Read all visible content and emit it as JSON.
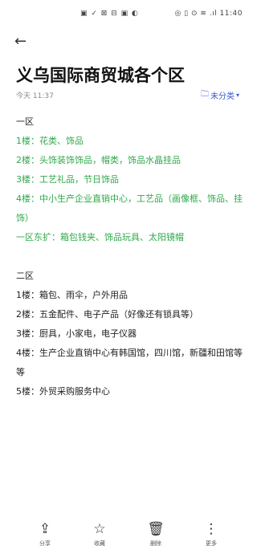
{
  "status_bar": {
    "left_text": "▣ ✓ ⊠ ⊟ ▣ ◐",
    "right_text": "◎ ▯ ⊙ ≋ .ıl 11:40"
  },
  "title": "义乌国际商贸城各个区",
  "timestamp": "今天 11:37",
  "category_label": "未分类",
  "content": {
    "district1_head": "一区",
    "district1_lines": [
      "1楼：花类、饰品",
      "2楼：头饰装饰饰品，帽类，饰品水晶挂品",
      "3楼：工艺礼品，节日饰品",
      "4楼：中小生产企业直销中心，工艺品（画像框、饰品、挂饰）",
      "一区东扩：箱包钱夹、饰品玩具、太阳镜帽"
    ],
    "district2_head": "二区",
    "district2_lines": [
      "1楼：箱包、雨伞，户外用品",
      "2楼：五金配件、电子产品（好像还有锁具等）",
      "3楼：厨具，小家电，电子仪器",
      "4楼：生产企业直销中心有韩国馆，四川馆，新疆和田馆等等",
      "5楼：外贸采购服务中心"
    ]
  },
  "toolbar": {
    "share_label": "分享",
    "favorite_label": "收藏",
    "delete_label": "删除",
    "more_label": "更多"
  },
  "colors": {
    "green_text": "#2fa94a",
    "accent_blue": "#3a5ad7"
  }
}
